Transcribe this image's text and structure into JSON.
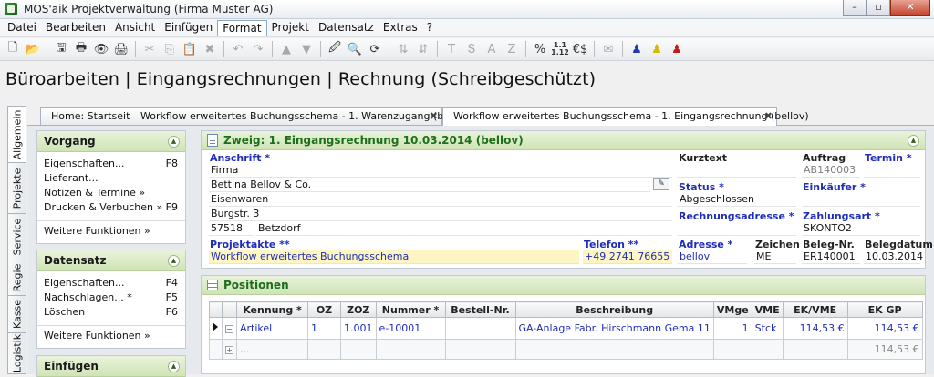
{
  "window": {
    "title": "MOS'aik Projektverwaltung (Firma Muster AG)",
    "btn_minimize": "–",
    "btn_maximize": "▫",
    "btn_close": "✕"
  },
  "menu": [
    "Datei",
    "Bearbeiten",
    "Ansicht",
    "Einfügen",
    "Format",
    "Projekt",
    "Datensatz",
    "Extras",
    "?"
  ],
  "toolbar": {
    "glyphs": [
      "🗋",
      "📂",
      "🖫",
      "🖶",
      "👁",
      "🖨",
      "✂",
      "⎘",
      "📋",
      "✖",
      "↶",
      "↷",
      "▲",
      "▼",
      "🖉",
      "🔍",
      "⟳",
      "⇅",
      "⇵",
      "T",
      "Տ",
      "A",
      "Z",
      "%",
      "1.1\n1.12",
      "€$",
      "✉",
      "♟",
      "♟",
      "♟"
    ]
  },
  "page_heading": "Büroarbeiten | Eingangsrechnungen | Rechnung (Schreibgeschützt)",
  "vtabs": [
    "Allgemein",
    "Projekte",
    "Service",
    "Regie",
    "Kasse",
    "Logistik"
  ],
  "doctabs": [
    {
      "label": "Home: Startseite",
      "close": ""
    },
    {
      "label": "Workflow erweitertes Buchungsschema - 1. Warenzugang (bellov)",
      "close": "✖"
    },
    {
      "label": "Workflow erweitertes Buchungsschema - 1. Eingangsrechnung (bellov)",
      "close": "✖"
    }
  ],
  "sidebar": {
    "vorgang": {
      "title": "Vorgang",
      "chevron": "▲",
      "items": [
        {
          "label": "Eigenschaften...",
          "key": "F8"
        },
        {
          "label": "Lieferant...",
          "key": ""
        },
        {
          "label": "Notizen & Termine »",
          "key": ""
        },
        {
          "label": "Drucken & Verbuchen »",
          "key": "F9"
        }
      ],
      "more": "Weitere Funktionen »"
    },
    "datensatz": {
      "title": "Datensatz",
      "chevron": "▲",
      "items": [
        {
          "label": "Eigenschaften...",
          "key": "F4"
        },
        {
          "label": "Nachschlagen... *",
          "key": "F5"
        },
        {
          "label": "Löschen",
          "key": "F6"
        }
      ],
      "more": "Weitere Funktionen »"
    },
    "einfuegen": {
      "title": "Einfügen",
      "chevron": "▲"
    }
  },
  "form": {
    "title": "Zweig: 1. Eingangsrechnung 10.03.2014 (bellov)",
    "chevron": "▲",
    "anschrift_label": "Anschrift *",
    "anschrift": [
      "Firma",
      "Bettina Bellov & Co.",
      "Eisenwaren",
      "Burgstr. 3"
    ],
    "plz": "57518",
    "ort": "Betzdorf",
    "edit_icon": "✎",
    "projektakte_label": "Projektakte **",
    "projektakte": "Workflow erweitertes Buchungsschema",
    "telefon_label": "Telefon **",
    "telefon": "+49 2741 76655",
    "kurztext_label": "Kurztext",
    "kurztext": "",
    "auftrag_label": "Auftrag",
    "auftrag": "AB140003",
    "termin_label": "Termin *",
    "termin": "",
    "status_label": "Status *",
    "status": "Abgeschlossen",
    "einkaeufer_label": "Einkäufer *",
    "einkaeufer": "",
    "rechnungsadresse_label": "Rechnungsadresse *",
    "rechnungsadresse": "",
    "zahlungsart_label": "Zahlungsart *",
    "zahlungsart": "SKONTO2",
    "adresse_label": "Adresse *",
    "adresse": "bellov",
    "zeichen_label": "Zeichen",
    "zeichen": "ME",
    "belegnr_label": "Beleg-Nr.",
    "belegnr": "ER140001",
    "belegdatum_label": "Belegdatum",
    "belegdatum": "10.03.2014"
  },
  "positionen": {
    "title": "Positionen",
    "columns": [
      "",
      "",
      "Kennung *",
      "OZ",
      "ZOZ",
      "Nummer *",
      "Bestell-Nr.",
      "Beschreibung",
      "VMge",
      "VME",
      "EK/VME",
      "EK GP"
    ],
    "rows": [
      {
        "kennung": "Artikel",
        "oz": "1",
        "zoz": "1.001",
        "nummer": "e-10001",
        "bestell": "",
        "beschreibung": "GA-Anlage Fabr. Hirschmann Gema 11",
        "vmge": "1",
        "vme": "Stck",
        "ek_vme": "114,53 €",
        "ek_gp": "114,53 €",
        "expander": "−"
      },
      {
        "kennung": "...",
        "oz": "",
        "zoz": "",
        "nummer": "",
        "bestell": "",
        "beschreibung": "",
        "vmge": "",
        "vme": "",
        "ek_vme": "",
        "ek_gp": "114,53 €",
        "expander": "+"
      }
    ]
  }
}
